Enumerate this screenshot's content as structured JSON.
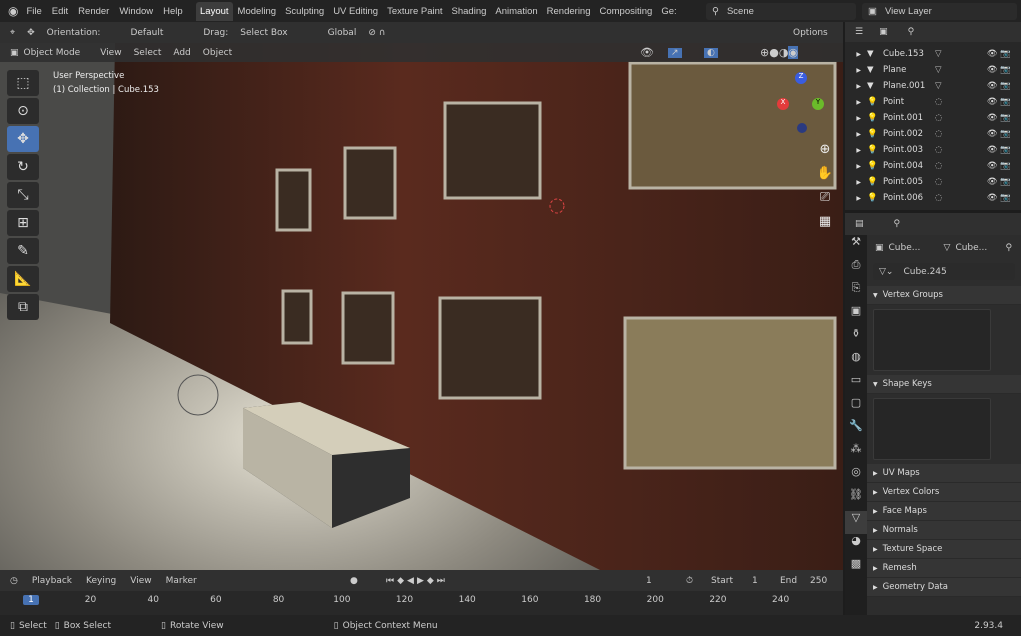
{
  "topbar": {
    "menus": [
      "File",
      "Edit",
      "Render",
      "Window",
      "Help"
    ],
    "workspaces": [
      "Layout",
      "Modeling",
      "Sculpting",
      "UV Editing",
      "Texture Paint",
      "Shading",
      "Animation",
      "Rendering",
      "Compositing",
      "Ge:"
    ],
    "active_workspace": "Layout",
    "scene": "Scene",
    "view_layer": "View Layer"
  },
  "header": {
    "orientation_label": "Orientation:",
    "orientation": "Default",
    "drag_label": "Drag:",
    "drag": "Select Box",
    "transform": "Global",
    "options": "Options"
  },
  "viewport_header": {
    "mode": "Object Mode",
    "menus": [
      "View",
      "Select",
      "Add",
      "Object"
    ]
  },
  "viewport": {
    "perspective": "User Perspective",
    "collection": "(1) Collection | Cube.153",
    "gizmo": {
      "x": "X",
      "y": "Y",
      "z": "Z"
    }
  },
  "outliner": {
    "items": [
      {
        "name": "Cube.153",
        "type": "mesh"
      },
      {
        "name": "Plane",
        "type": "mesh"
      },
      {
        "name": "Plane.001",
        "type": "mesh"
      },
      {
        "name": "Point",
        "type": "light"
      },
      {
        "name": "Point.001",
        "type": "light"
      },
      {
        "name": "Point.002",
        "type": "light"
      },
      {
        "name": "Point.003",
        "type": "light"
      },
      {
        "name": "Point.004",
        "type": "light"
      },
      {
        "name": "Point.005",
        "type": "light"
      },
      {
        "name": "Point.006",
        "type": "light"
      }
    ]
  },
  "properties": {
    "object": "Cube...",
    "data": "Cube...",
    "mesh": "Cube.245",
    "panels": {
      "vertex_groups": "Vertex Groups",
      "shape_keys": "Shape Keys",
      "collapsed": [
        "UV Maps",
        "Vertex Colors",
        "Face Maps",
        "Normals",
        "Texture Space",
        "Remesh",
        "Geometry Data"
      ]
    }
  },
  "timeline": {
    "menus": [
      "Playback",
      "Keying",
      "View",
      "Marker"
    ],
    "current_frame": "1",
    "start_label": "Start",
    "start": "1",
    "end_label": "End",
    "end": "250",
    "ticks": [
      "1",
      "20",
      "40",
      "60",
      "80",
      "100",
      "120",
      "140",
      "160",
      "180",
      "200",
      "220",
      "240"
    ]
  },
  "status": {
    "select": "Select",
    "box_select": "Box Select",
    "rotate": "Rotate View",
    "context": "Object Context Menu",
    "version": "2.93.4"
  },
  "colors": {
    "accent": "#4772b3",
    "x_axis": "#e33b3b",
    "y_axis": "#6bbb2a",
    "z_axis": "#3a5de0"
  }
}
